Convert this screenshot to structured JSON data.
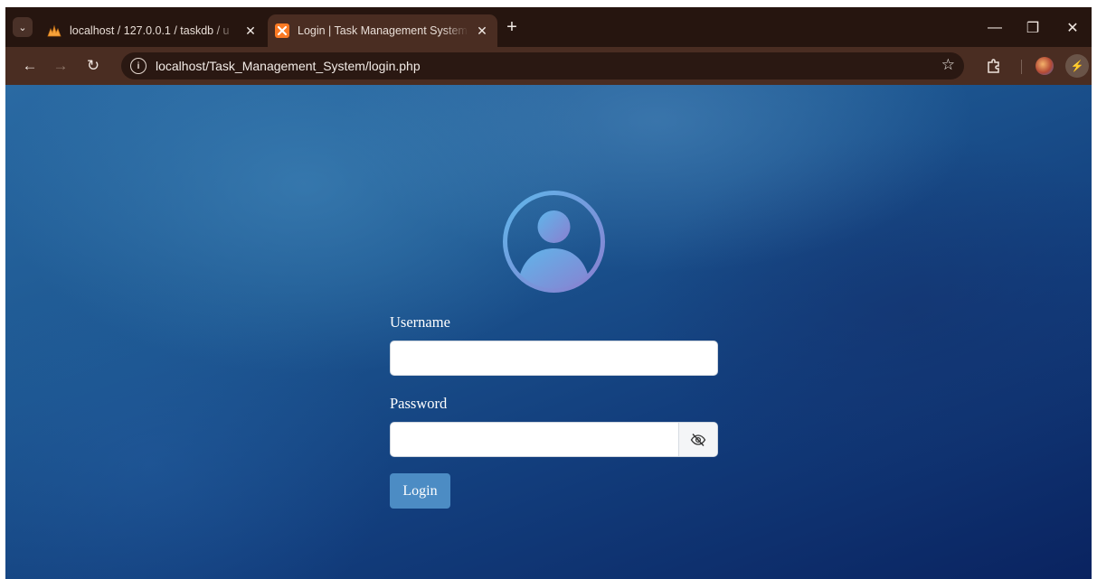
{
  "browser": {
    "tabs": [
      {
        "title": "localhost / 127.0.0.1 / taskdb / u",
        "favicon": "phpmyadmin-icon",
        "active": false
      },
      {
        "title": "Login | Task Management System",
        "favicon": "xampp-icon",
        "active": true
      }
    ],
    "close_glyph": "✕",
    "new_tab_glyph": "+",
    "url": "localhost/Task_Management_System/login.php",
    "window_controls": {
      "minimize": "—",
      "restore": "❐",
      "close": "✕"
    }
  },
  "login_form": {
    "username_label": "Username",
    "username_value": "",
    "password_label": "Password",
    "password_value": "",
    "submit_label": "Login"
  },
  "colors": {
    "accent": "#4c8cc4",
    "avatar_gradient_start": "#5fb6ea",
    "avatar_gradient_end": "#8a7fd0"
  }
}
